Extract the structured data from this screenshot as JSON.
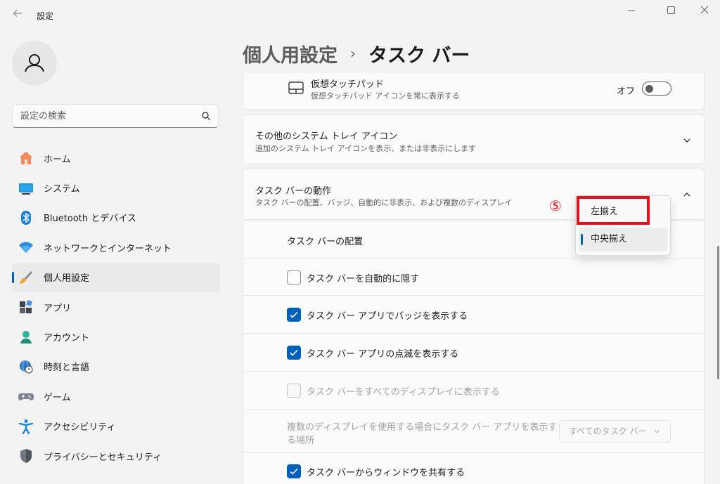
{
  "window": {
    "title": "設定",
    "back_icon": "arrow-left-icon"
  },
  "sidebar": {
    "search_placeholder": "設定の検索",
    "items": [
      {
        "label": "ホーム",
        "icon": "home-icon"
      },
      {
        "label": "システム",
        "icon": "monitor-icon"
      },
      {
        "label": "Bluetooth とデバイス",
        "icon": "bluetooth-icon"
      },
      {
        "label": "ネットワークとインターネット",
        "icon": "wifi-icon"
      },
      {
        "label": "個人用設定",
        "icon": "paintbrush-icon",
        "active": true
      },
      {
        "label": "アプリ",
        "icon": "apps-icon"
      },
      {
        "label": "アカウント",
        "icon": "account-icon"
      },
      {
        "label": "時刻と言語",
        "icon": "globe-clock-icon"
      },
      {
        "label": "ゲーム",
        "icon": "gamepad-icon"
      },
      {
        "label": "アクセシビリティ",
        "icon": "accessibility-icon"
      },
      {
        "label": "プライバシーとセキュリティ",
        "icon": "shield-icon"
      }
    ]
  },
  "breadcrumb": {
    "parent": "個人用設定",
    "separator": "›",
    "current": "タスク バー"
  },
  "touchpad": {
    "title": "仮想タッチパッド",
    "subtitle": "仮想タッチパッド アイコンを常に表示する",
    "toggle_label": "オフ",
    "toggle_on": false
  },
  "tray": {
    "title": "その他のシステム トレイ アイコン",
    "subtitle": "追加のシステム トレイ アイコンを表示、または非表示にします"
  },
  "behaviors": {
    "title": "タスク バーの動作",
    "subtitle": "タスク バーの配置、バッジ、自動的に非表示、および複数のディスプレイ",
    "alignment_label": "タスク バーの配置",
    "options": [
      {
        "label": "左揃え",
        "selected": false
      },
      {
        "label": "中央揃え",
        "selected": true
      }
    ],
    "auto_hide": {
      "label": "タスク バーを自動的に隠す",
      "checked": false
    },
    "badges": {
      "label": "タスク バー アプリでバッジを表示する",
      "checked": true
    },
    "flashing": {
      "label": "タスク バー アプリの点滅を表示する",
      "checked": true
    },
    "all_displays": {
      "label": "タスク バーをすべてのディスプレイに表示する",
      "checked": false,
      "disabled": true
    },
    "multi_display": {
      "label_line1": "複数のディスプレイを使用する場合にタスク バー アプリを表示す",
      "label_line2": "る場所",
      "select_value": "すべてのタスク バー"
    },
    "share_window": {
      "label": "タスク バーからウィンドウを共有する",
      "checked": true
    }
  },
  "annotation": {
    "step": "⑤",
    "color": "#e3101b"
  },
  "colors": {
    "accent": "#005fb8",
    "background": "#f3f3f3",
    "card": "#fbfbfb"
  }
}
